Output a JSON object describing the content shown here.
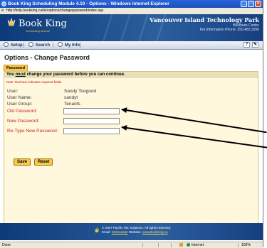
{
  "window": {
    "title": "Book King Scheduling Module 4.10 - Options - Windows Internet Explorer",
    "minimize": "_",
    "maximize": "□",
    "close": "×"
  },
  "address": {
    "url": "http://help.bookking.ca/bk/options/changepassword/index.asp"
  },
  "header": {
    "brand": "Book King",
    "brand_sub": "Scheduling Module",
    "org_name": "Vancouver Island Technology Park",
    "org_sub": "Business Centre",
    "org_phone": "For Information Phone: 250.483.3206"
  },
  "nav": {
    "setup": "Setup",
    "search": "Search",
    "myinfo": "My Info",
    "help_label": "?"
  },
  "page": {
    "title": "Options - Change Password",
    "tab": "Password"
  },
  "form": {
    "must_prefix": "You ",
    "must_word": "must",
    "must_suffix": " change your password before you can continue.",
    "required_note": "Note: Red text indicates required fields.",
    "user_label": "User:",
    "user_value": "Sandy Toogood",
    "username_label": "User Name:",
    "username_value": "sandyt",
    "group_label": "User Group:",
    "group_value": "Tenants",
    "old_label": "Old Password:",
    "new_label": "New Password:",
    "retype_label": "Re-Type New Password:",
    "save": "Save",
    "reset": "Reset"
  },
  "footer": {
    "copyright": "© 2007 Pacific Tier Solutions. All rights reserved.",
    "email_prefix": "Email: ",
    "email_link": "Webmaster",
    "website_prefix": " Website: ",
    "website_link": "www.BookKing.ca"
  },
  "status": {
    "left": "Done",
    "zone": "Internet",
    "zoom": "100%"
  },
  "colors": {
    "header_blue": "#1b4f8f",
    "accent_gold": "#f7c84a",
    "required_red": "#d02020"
  }
}
